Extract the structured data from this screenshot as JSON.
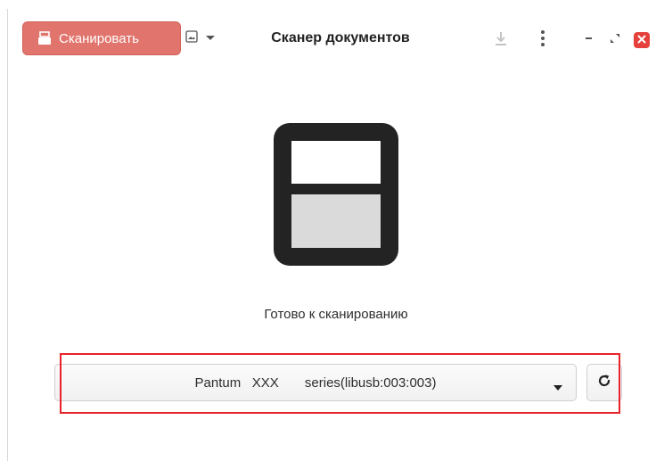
{
  "header": {
    "scan_button_label": "Сканировать",
    "title": "Сканер документов",
    "icons": {
      "scan": "scanner-icon",
      "page_type": "image-icon",
      "page_type_menu": "chevron-down-icon",
      "save": "download-icon",
      "menu": "kebab-menu-icon",
      "minimize": "minimize-icon",
      "maximize": "maximize-icon",
      "close": "close-icon"
    }
  },
  "main": {
    "status": "Готово к сканированию"
  },
  "device_selector": {
    "selected": "Pantum   XXX       series(libusb:003:003)",
    "dropdown_icon": "dropdown-arrow-icon",
    "refresh_icon": "refresh-icon"
  },
  "colors": {
    "accent": "#e1746c",
    "close": "#e5403b",
    "highlight": "#e8222a"
  }
}
